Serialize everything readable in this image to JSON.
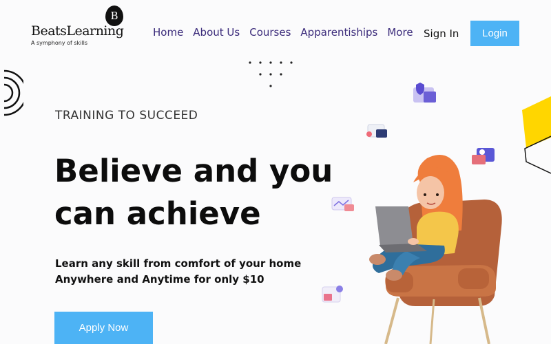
{
  "brand": {
    "badge": "B",
    "name": "BeatsLearning",
    "tagline": "A symphony of skills"
  },
  "nav": {
    "items": [
      "Home",
      "About Us",
      "Courses",
      "Apparentiships",
      "More"
    ],
    "signin_label": "Sign In",
    "login_label": "Login"
  },
  "hero": {
    "eyebrow": "TRAINING TO SUCCEED",
    "headline": "Believe and you can achieve",
    "subline_1": "Learn any skill from comfort of your home",
    "subline_2": "Anywhere and Anytime for only $10",
    "cta_label": "Apply Now"
  },
  "colors": {
    "accent": "#4db3f5",
    "nav_text": "#3a2a7a",
    "hair": "#ef7d3c",
    "chair": "#b5613a",
    "hexagon": "#ffd600"
  }
}
